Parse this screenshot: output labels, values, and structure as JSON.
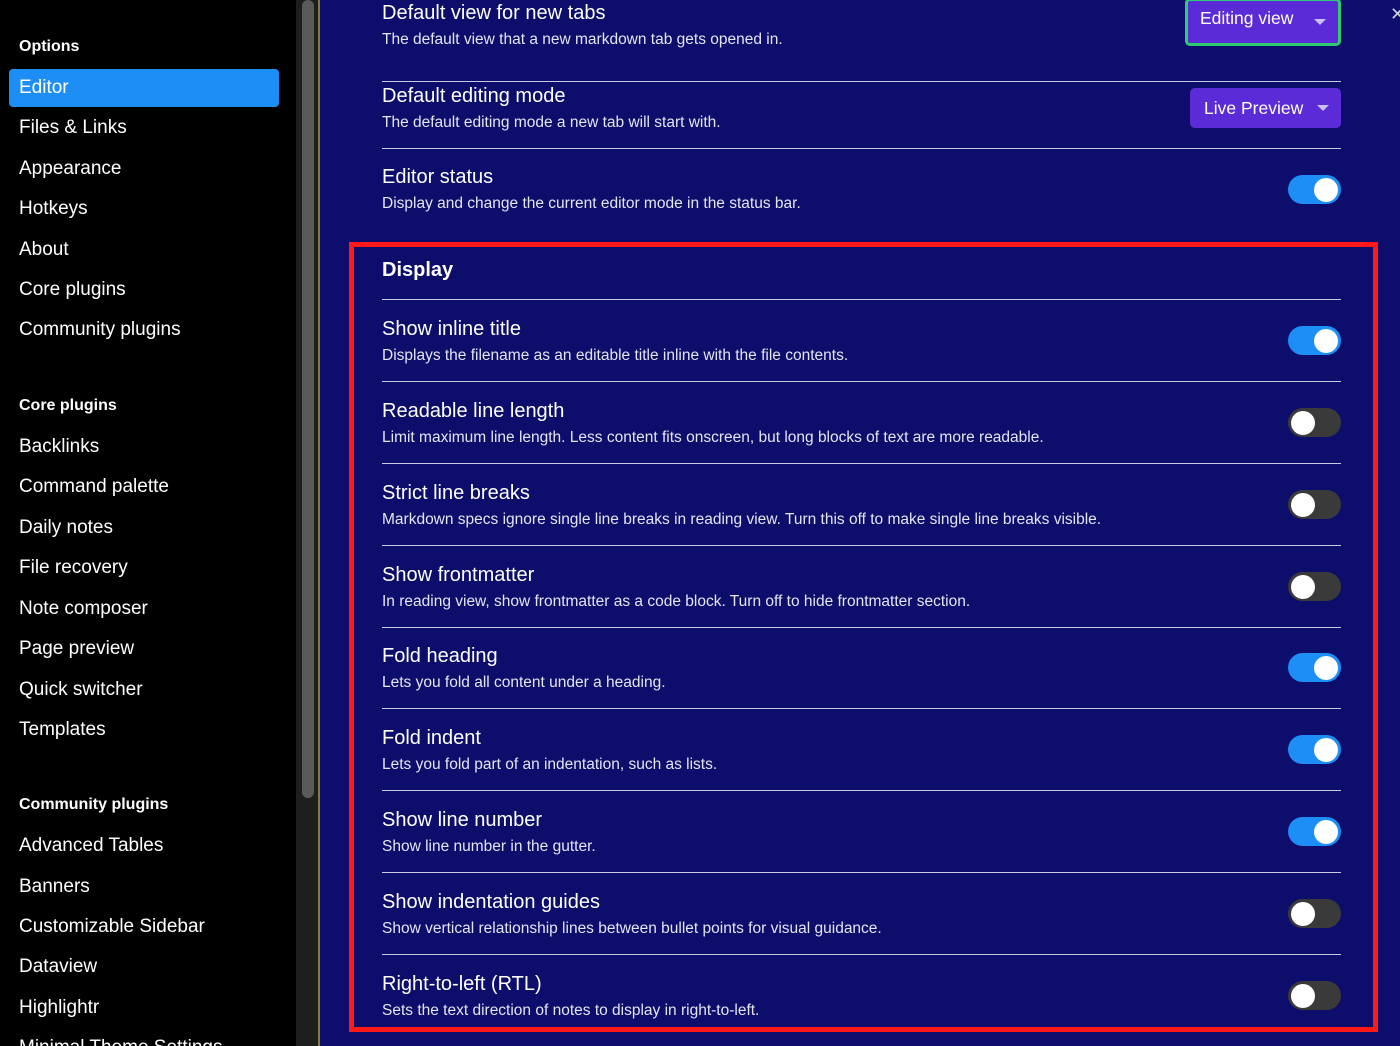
{
  "sidebar": {
    "sections": [
      {
        "heading": "Options",
        "items": [
          {
            "label": "Editor",
            "active": true
          },
          {
            "label": "Files & Links"
          },
          {
            "label": "Appearance"
          },
          {
            "label": "Hotkeys"
          },
          {
            "label": "About"
          },
          {
            "label": "Core plugins"
          },
          {
            "label": "Community plugins"
          }
        ]
      },
      {
        "heading": "Core plugins",
        "items": [
          {
            "label": "Backlinks"
          },
          {
            "label": "Command palette"
          },
          {
            "label": "Daily notes"
          },
          {
            "label": "File recovery"
          },
          {
            "label": "Note composer"
          },
          {
            "label": "Page preview"
          },
          {
            "label": "Quick switcher"
          },
          {
            "label": "Templates"
          }
        ]
      },
      {
        "heading": "Community plugins",
        "items": [
          {
            "label": "Advanced Tables"
          },
          {
            "label": "Banners"
          },
          {
            "label": "Customizable Sidebar"
          },
          {
            "label": "Dataview"
          },
          {
            "label": "Highlightr"
          },
          {
            "label": "Minimal Theme Settings"
          }
        ]
      }
    ]
  },
  "close_icon": "✕",
  "general_settings": [
    {
      "name": "Default view for new tabs",
      "desc": "The default view that a new markdown tab gets opened in.",
      "control": "dropdown",
      "value": "Editing view",
      "focused": true
    },
    {
      "name": "Default editing mode",
      "desc": "The default editing mode a new tab will start with.",
      "control": "dropdown",
      "value": "Live Preview"
    },
    {
      "name": "Editor status",
      "desc": "Display and change the current editor mode in the status bar.",
      "control": "toggle",
      "on": true
    }
  ],
  "display_section": {
    "heading": "Display",
    "settings": [
      {
        "name": "Show inline title",
        "desc": "Displays the filename as an editable title inline with the file contents.",
        "on": true
      },
      {
        "name": "Readable line length",
        "desc": "Limit maximum line length. Less content fits onscreen, but long blocks of text are more readable.",
        "on": false
      },
      {
        "name": "Strict line breaks",
        "desc": "Markdown specs ignore single line breaks in reading view. Turn this off to make single line breaks visible.",
        "on": false
      },
      {
        "name": "Show frontmatter",
        "desc": "In reading view, show frontmatter as a code block. Turn off to hide frontmatter section.",
        "on": false
      },
      {
        "name": "Fold heading",
        "desc": "Lets you fold all content under a heading.",
        "on": true
      },
      {
        "name": "Fold indent",
        "desc": "Lets you fold part of an indentation, such as lists.",
        "on": true
      },
      {
        "name": "Show line number",
        "desc": "Show line number in the gutter.",
        "on": true
      },
      {
        "name": "Show indentation guides",
        "desc": "Show vertical relationship lines between bullet points for visual guidance.",
        "on": false
      },
      {
        "name": "Right-to-left (RTL)",
        "desc": "Sets the text direction of notes to display in right-to-left.",
        "on": false
      }
    ]
  },
  "colors": {
    "background": "#0d0d6b",
    "sidebar": "#000000",
    "accent": "#1c8ef5",
    "dropdown": "#5a2bd6",
    "focus_outline": "#2ecc71",
    "highlight_box": "#ff1a1a"
  }
}
